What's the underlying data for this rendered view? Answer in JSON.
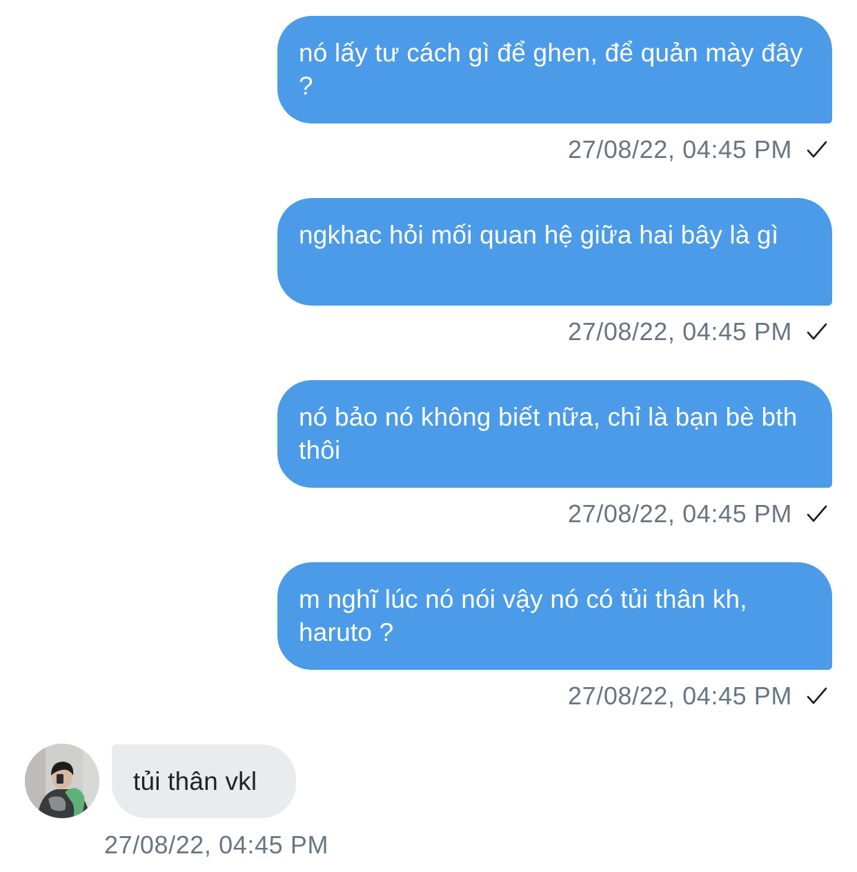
{
  "messages": [
    {
      "direction": "outgoing",
      "text": "nó lấy tư cách gì để ghen, để quản mày đây ?",
      "timestamp": "27/08/22, 04:45 PM",
      "status_icon": "checkmark-icon"
    },
    {
      "direction": "outgoing",
      "text": "ngkhac hỏi mối quan hệ giữa hai bây là gì",
      "timestamp": "27/08/22, 04:45 PM",
      "status_icon": "checkmark-icon"
    },
    {
      "direction": "outgoing",
      "text": "nó bảo nó không biết nữa, chỉ là bạn bè bth thôi",
      "timestamp": "27/08/22, 04:45 PM",
      "status_icon": "checkmark-icon"
    },
    {
      "direction": "outgoing",
      "text": "m nghĩ lúc nó nói vậy nó có tủi thân kh, haruto ?",
      "timestamp": "27/08/22, 04:45 PM",
      "status_icon": "checkmark-icon"
    },
    {
      "direction": "incoming",
      "text": "tủi thân vkl",
      "timestamp": "27/08/22, 04:45 PM",
      "avatar": "user-avatar-photo"
    }
  ],
  "colors": {
    "outgoing_bubble": "#4c9be8",
    "incoming_bubble": "#e9ebee",
    "timestamp_text": "#677583",
    "background": "#ffffff"
  }
}
